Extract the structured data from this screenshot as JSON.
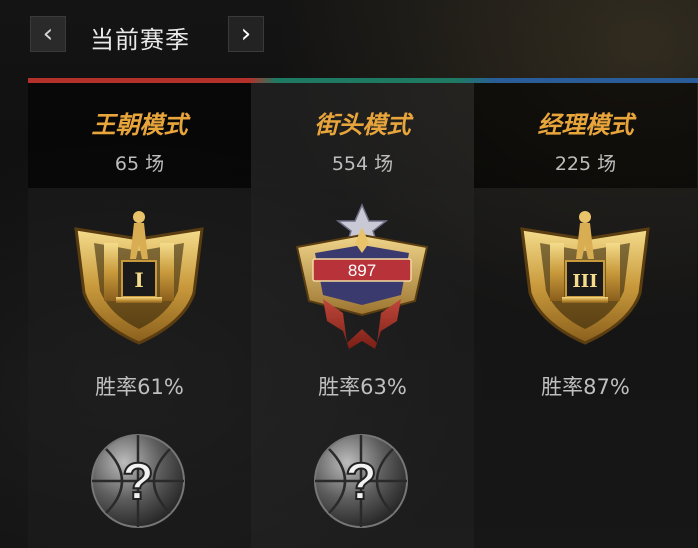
{
  "header": {
    "title": "当前赛季",
    "prev_icon": "chevron-left-icon",
    "next_icon": "chevron-right-icon"
  },
  "colors": {
    "mode_name": "#e8a53b",
    "divider_segments": [
      "#b3312a",
      "#1f7a63",
      "#2a5c9a"
    ]
  },
  "modes": [
    {
      "name": "王朝模式",
      "count": "65 场",
      "rank_icon": "gold-trophy-rank-I-icon",
      "win_rate": "胜率61%",
      "reward_icon": "mystery-basketball-icon"
    },
    {
      "name": "街头模式",
      "count": "554 场",
      "rank_icon": "star-shield-rank-icon",
      "rank_value": "897",
      "win_rate": "胜率63%",
      "reward_icon": "mystery-basketball-icon"
    },
    {
      "name": "经理模式",
      "count": "225 场",
      "rank_icon": "gold-trophy-rank-III-icon",
      "win_rate": "胜率87%"
    }
  ]
}
